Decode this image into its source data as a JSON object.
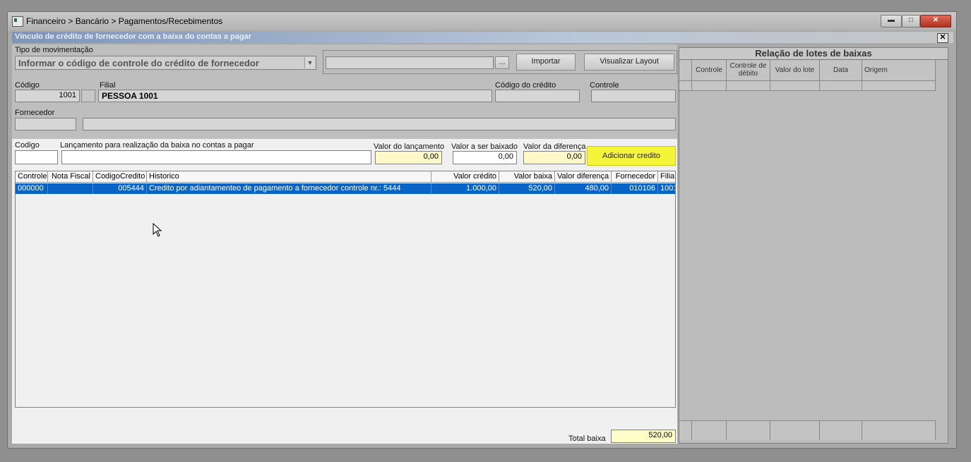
{
  "window": {
    "title": "Financeiro > Bancário > Pagamentos/Recebimentos",
    "subtitle": "Vínculo de crédito de fornecedor com a baixa do contas a pagar"
  },
  "form": {
    "tipo_label": "Tipo de  movimentação",
    "tipo_value": "Informar o código de controle do crédito de fornecedor",
    "file_path": "",
    "browse_label": "...",
    "importar_label": "Importar",
    "visualizar_label": "Visualizar Layout",
    "codigo_label": "Código",
    "codigo_value": "1001",
    "filial_label": "Filial",
    "filial_value": "PESSOA 1001",
    "codigo_credito_label": "Código do crédito",
    "codigo_credito_value": "",
    "controle_label": "Controle",
    "controle_value": "",
    "fornecedor_label": "Fornecedor",
    "fornecedor_code": "",
    "fornecedor_name": ""
  },
  "entry": {
    "codigo_label": "Codigo",
    "codigo_value": "",
    "lancamento_label": "Lançamento para realização da baixa no contas a pagar",
    "lancamento_value": "",
    "valor_lancamento_label": "Valor do lançamento",
    "valor_lancamento_value": "0,00",
    "valor_baixado_label": "Valor a ser baixado",
    "valor_baixado_value": "0,00",
    "valor_diferenca_label": "Valor da diferença",
    "valor_diferenca_value": "0,00",
    "adicionar_label": "Adicionar credito"
  },
  "grid": {
    "columns": [
      "Controle",
      "Nota Fiscal",
      "CodigoCredito",
      "Historico",
      "Valor crédito",
      "Valor baixa",
      "Valor diferença",
      "Fornecedor",
      "Filia"
    ],
    "rows": [
      [
        "000000",
        "",
        "005444",
        "Credito por adiantamenteo de pagamento a fornecedor controle nr.: 5444",
        "1.000,00",
        "520,00",
        "480,00",
        "010106",
        "1001"
      ]
    ]
  },
  "total": {
    "label": "Total baixa",
    "value": "520,00"
  },
  "lotes": {
    "title": "Relação de lotes de baixas",
    "columns": [
      "Controle",
      "Controle de débito",
      "Valor do lote",
      "Data",
      "Origem"
    ]
  },
  "colors": {
    "selection": "#0a64c8",
    "highlight_button": "#f4f43a",
    "yellow_field": "#fff8c8"
  }
}
